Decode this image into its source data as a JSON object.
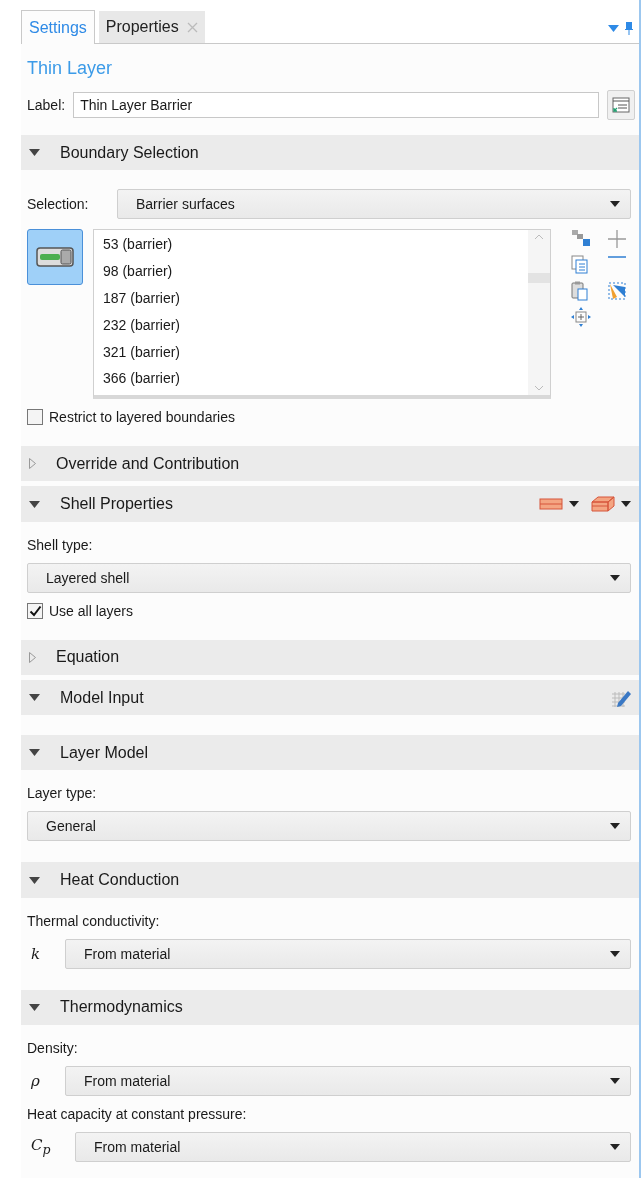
{
  "tabs": [
    {
      "label": "Settings",
      "selected": true,
      "closable": false
    },
    {
      "label": "Properties",
      "selected": false,
      "closable": true
    }
  ],
  "title": "Thin Layer",
  "label_field": {
    "label": "Label:",
    "value": "Thin Layer Barrier"
  },
  "sections": [
    {
      "title": "Boundary Selection",
      "expanded": true,
      "kind": "plain",
      "items": [
        {
          "kind": "selection",
          "label": "Selection:",
          "value": "Barrier surfaces",
          "entries": [
            "53 (barrier)",
            "98 (barrier)",
            "187 (barrier)",
            "232 (barrier)",
            "321 (barrier)",
            "366 (barrier)"
          ]
        },
        {
          "kind": "checkbox",
          "label": "Restrict to layered boundaries",
          "checked": false
        }
      ]
    },
    {
      "title": "Override and Contribution",
      "expanded": false,
      "kind": "plain"
    },
    {
      "title": "Shell Properties",
      "expanded": true,
      "kind": "layers",
      "items": [
        {
          "kind": "caption",
          "text": "Shell type:"
        },
        {
          "kind": "dropdown",
          "value": "Layered shell"
        },
        {
          "kind": "checkbox",
          "label": "Use all layers",
          "checked": true
        }
      ]
    },
    {
      "title": "Equation",
      "expanded": false,
      "kind": "plain"
    },
    {
      "title": "Model Input",
      "expanded": true,
      "kind": "edit"
    },
    {
      "title": "Layer Model",
      "expanded": true,
      "kind": "plain",
      "items": [
        {
          "kind": "caption",
          "text": "Layer type:"
        },
        {
          "kind": "dropdown",
          "value": "General"
        }
      ]
    },
    {
      "title": "Heat Conduction",
      "expanded": true,
      "kind": "plain",
      "items": [
        {
          "kind": "caption",
          "text": "Thermal conductivity:"
        },
        {
          "kind": "dropdown",
          "symbol": "k",
          "value": "From material"
        }
      ]
    },
    {
      "title": "Thermodynamics",
      "expanded": true,
      "kind": "plain",
      "items": [
        {
          "kind": "caption",
          "text": "Density:"
        },
        {
          "kind": "dropdown",
          "symbol": "ρ",
          "value": "From material"
        },
        {
          "kind": "caption",
          "text": "Heat capacity at constant pressure:"
        },
        {
          "kind": "dropdown",
          "symbol": "C$_{p}$",
          "value": "From material"
        }
      ]
    }
  ]
}
